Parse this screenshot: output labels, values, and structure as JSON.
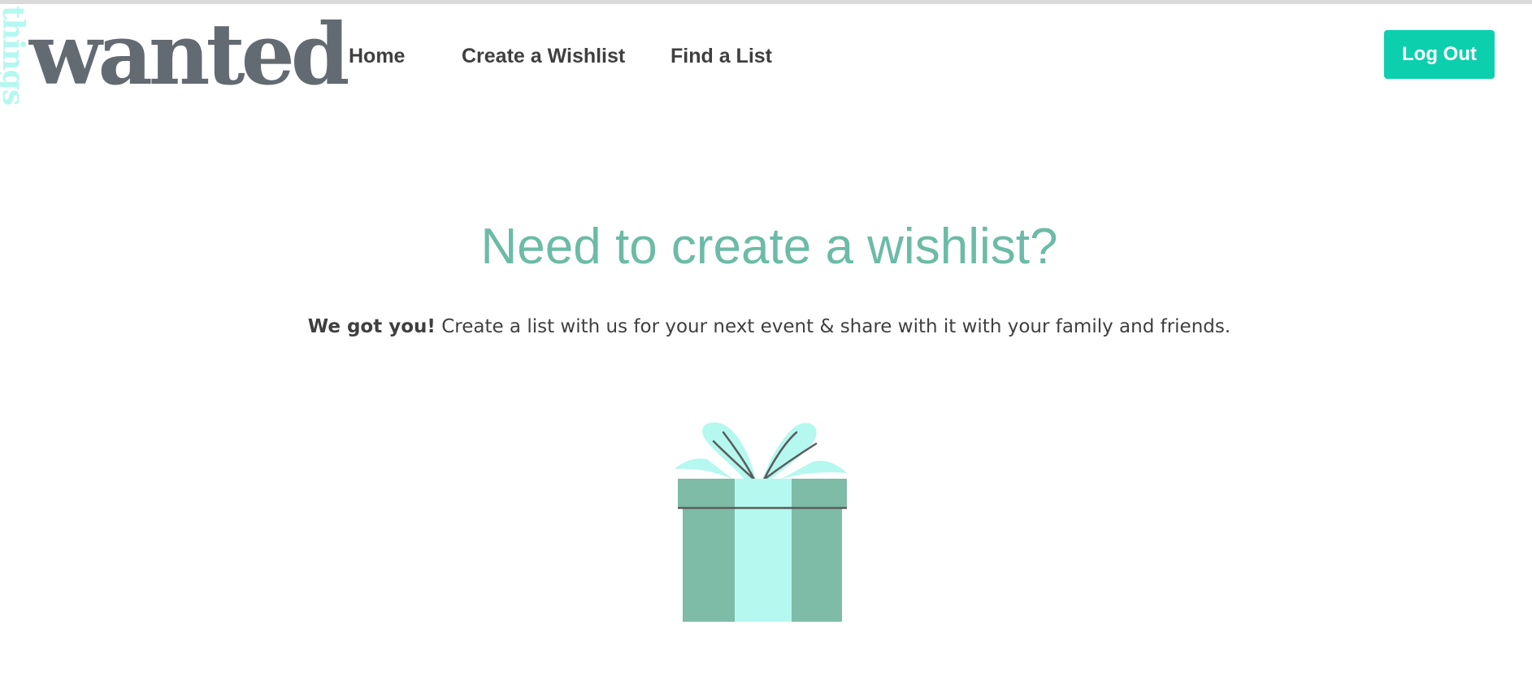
{
  "brand": {
    "small_word": "things",
    "main_word": "wanted"
  },
  "nav": {
    "items": [
      {
        "label": "Home"
      },
      {
        "label": "Create a Wishlist"
      },
      {
        "label": "Find a List"
      }
    ],
    "logout_label": "Log Out"
  },
  "hero": {
    "title": "Need to create a wishlist?",
    "subtitle_bold": "We got you!",
    "subtitle_rest": " Create a list with us for your next event & share with it with your family and friends."
  },
  "illustration": {
    "icon": "gift-icon"
  },
  "colors": {
    "accent": "#0ccfae",
    "title": "#6cbba6",
    "logo_text": "#636a72",
    "logo_small": "#b4f8ef",
    "gift_box": "#7fbca8",
    "gift_ribbon": "#b4f8ef"
  }
}
